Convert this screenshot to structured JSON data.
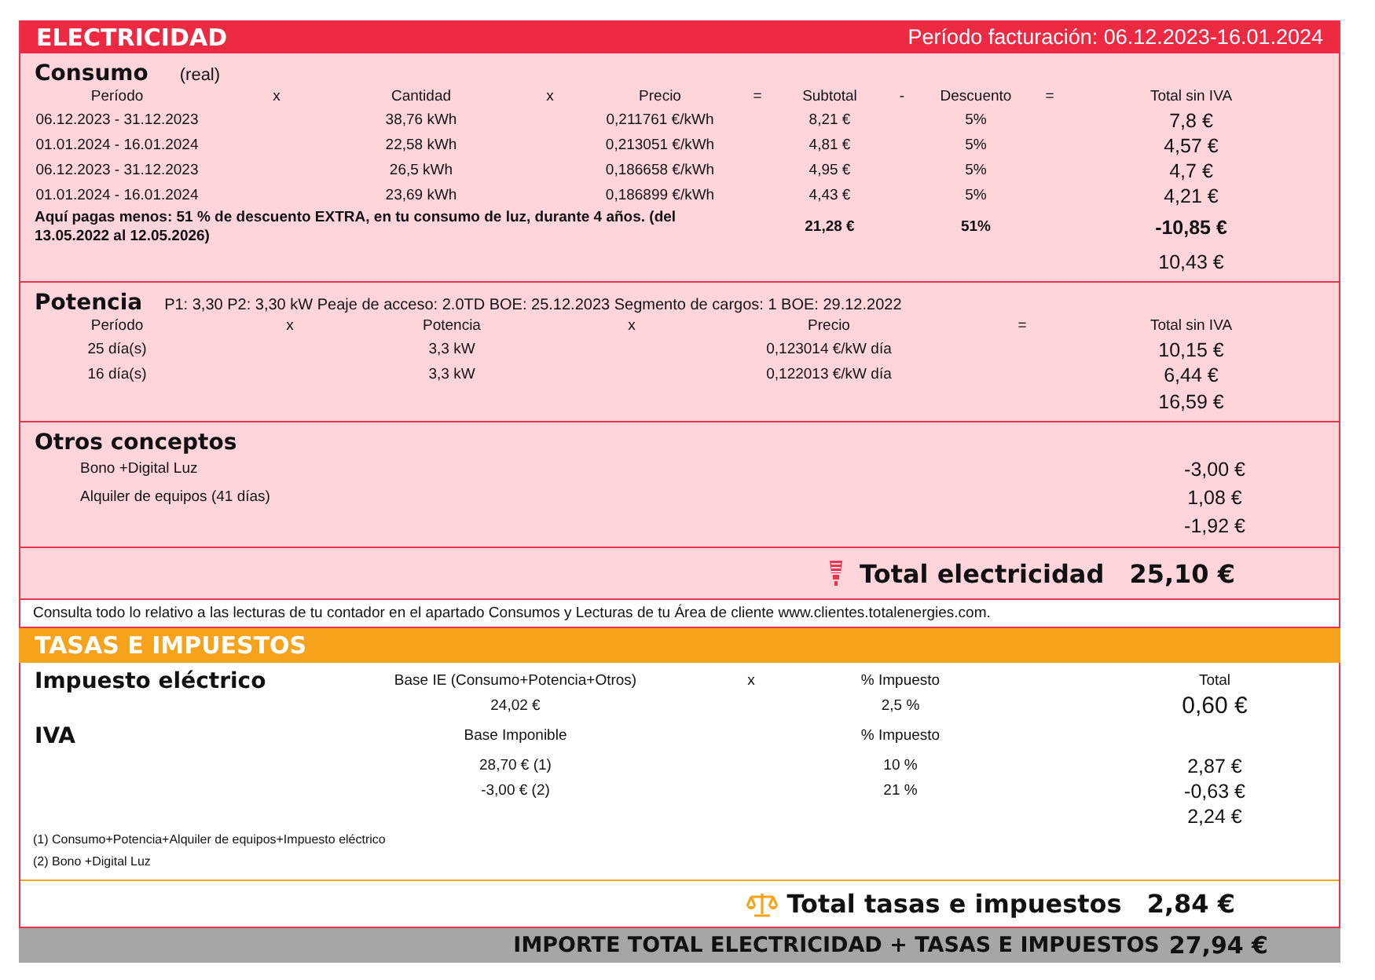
{
  "electricidad": {
    "title": "ELECTRICIDAD",
    "period": "Período facturación: 06.12.2023-16.01.2024"
  },
  "consumo": {
    "title": "Consumo",
    "note": "(real)",
    "columns": [
      "Período",
      "x",
      "Cantidad",
      "x",
      "Precio",
      "=",
      "Subtotal",
      "-",
      "Descuento",
      "=",
      "Total sin IVA"
    ],
    "rows": [
      {
        "periodo": "06.12.2023 - 31.12.2023",
        "cantidad": "38,76 kWh",
        "precio": "0,211761 €/kWh",
        "subtotal": "8,21 €",
        "descuento": "5%",
        "total": "7,8 €"
      },
      {
        "periodo": "01.01.2024 - 16.01.2024",
        "cantidad": "22,58 kWh",
        "precio": "0,213051 €/kWh",
        "subtotal": "4,81 €",
        "descuento": "5%",
        "total": "4,57 €"
      },
      {
        "periodo": "06.12.2023 - 31.12.2023",
        "cantidad": "26,5 kWh",
        "precio": "0,186658 €/kWh",
        "subtotal": "4,95 €",
        "descuento": "5%",
        "total": "4,7 €"
      },
      {
        "periodo": "01.01.2024 - 16.01.2024",
        "cantidad": "23,69 kWh",
        "precio": "0,186899 €/kWh",
        "subtotal": "4,43 €",
        "descuento": "5%",
        "total": "4,21 €"
      }
    ],
    "discount": {
      "text": "Aquí pagas menos: 51 % de descuento EXTRA, en tu consumo de luz, durante 4 años. (del 13.05.2022 al 12.05.2026)",
      "subtotal": "21,28 €",
      "descuento": "51%",
      "total": "-10,85 €"
    },
    "sum": "10,43 €"
  },
  "potencia": {
    "title": "Potencia",
    "info": "P1: 3,30 P2: 3,30 kW  Peaje de acceso: 2.0TD  BOE: 25.12.2023  Segmento de cargos: 1  BOE: 29.12.2022",
    "columns": [
      "Período",
      "x",
      "Potencia",
      "x",
      "Precio",
      "=",
      "Total sin IVA"
    ],
    "rows": [
      {
        "periodo": "25 día(s)",
        "potencia": "3,3 kW",
        "precio": "0,123014 €/kW día",
        "total": "10,15 €"
      },
      {
        "periodo": "16 día(s)",
        "potencia": "3,3 kW",
        "precio": "0,122013 €/kW día",
        "total": "6,44 €"
      }
    ],
    "sum": "16,59 €"
  },
  "otros": {
    "title": "Otros conceptos",
    "rows": [
      {
        "label": "Bono +Digital Luz",
        "value": "-3,00 €"
      },
      {
        "label": "Alquiler de equipos (41 días)",
        "value": "1,08 €"
      }
    ],
    "sum": "-1,92 €"
  },
  "total_electricidad": {
    "label": "Total electricidad",
    "value": "25,10 €"
  },
  "note": "Consulta todo lo relativo a las lecturas de tu contador en el apartado Consumos y Lecturas de tu Área de cliente www.clientes.totalenergies.com.",
  "tasas": {
    "title": "TASAS E IMPUESTOS",
    "impuesto_electrico": {
      "title": "Impuesto eléctrico",
      "columns": [
        "Base IE (Consumo+Potencia+Otros)",
        "x",
        "% Impuesto",
        "Total"
      ],
      "base": "24,02 €",
      "pct": "2,5 %",
      "total": "0,60 €"
    },
    "iva": {
      "title": "IVA",
      "columns": [
        "Base Imponible",
        "% Impuesto"
      ],
      "rows": [
        {
          "base": "28,70 € (1)",
          "pct": "10 %",
          "total": "2,87 €"
        },
        {
          "base": "-3,00 € (2)",
          "pct": "21 %",
          "total": "-0,63 €"
        }
      ],
      "sum": "2,24 €"
    },
    "footnotes": [
      "(1) Consumo+Potencia+Alquiler de equipos+Impuesto eléctrico",
      "(2) Bono +Digital Luz"
    ],
    "total": {
      "label": "Total tasas e impuestos",
      "value": "2,84 €"
    }
  },
  "grand_total": {
    "label": "IMPORTE TOTAL ELECTRICIDAD + TASAS E IMPUESTOS",
    "value": "27,94 €"
  }
}
